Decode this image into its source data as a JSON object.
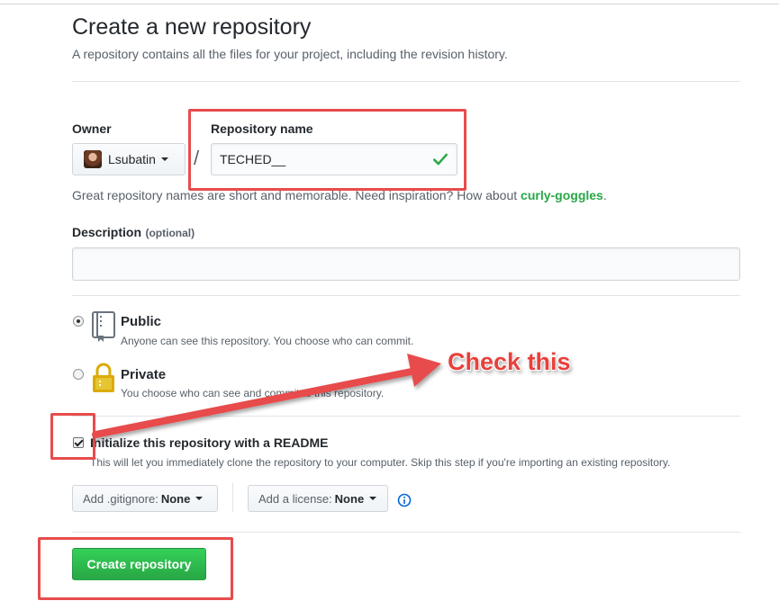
{
  "header": {
    "title": "Create a new repository",
    "subtitle": "A repository contains all the files for your project, including the revision history."
  },
  "owner": {
    "label": "Owner",
    "selected": "Lsubatin",
    "separator": "/"
  },
  "repository_name": {
    "label": "Repository name",
    "value": "TECHED__"
  },
  "hint": {
    "prefix": "Great repository names are short and memorable. Need inspiration? How about ",
    "suggestion": "curly-goggles",
    "suffix": "."
  },
  "description": {
    "label": "Description",
    "optional": "(optional)",
    "value": ""
  },
  "visibility": {
    "public": {
      "title": "Public",
      "note": "Anyone can see this repository. You choose who can commit.",
      "selected": true
    },
    "private": {
      "title": "Private",
      "note": "You choose who can see and commit to this repository.",
      "selected": false
    }
  },
  "readme": {
    "label": "Initialize this repository with a README",
    "note": "This will let you immediately clone the repository to your computer. Skip this step if you're importing an existing repository.",
    "checked": true
  },
  "gitignore": {
    "label": "Add .gitignore:",
    "value": "None"
  },
  "license": {
    "label": "Add a license:",
    "value": "None"
  },
  "submit": {
    "label": "Create repository"
  },
  "annotation": {
    "callout": "Check this",
    "color": "#e74c4c"
  },
  "colors": {
    "primary_button": "#28a745",
    "link": "#0366d6",
    "check": "#28a745"
  }
}
